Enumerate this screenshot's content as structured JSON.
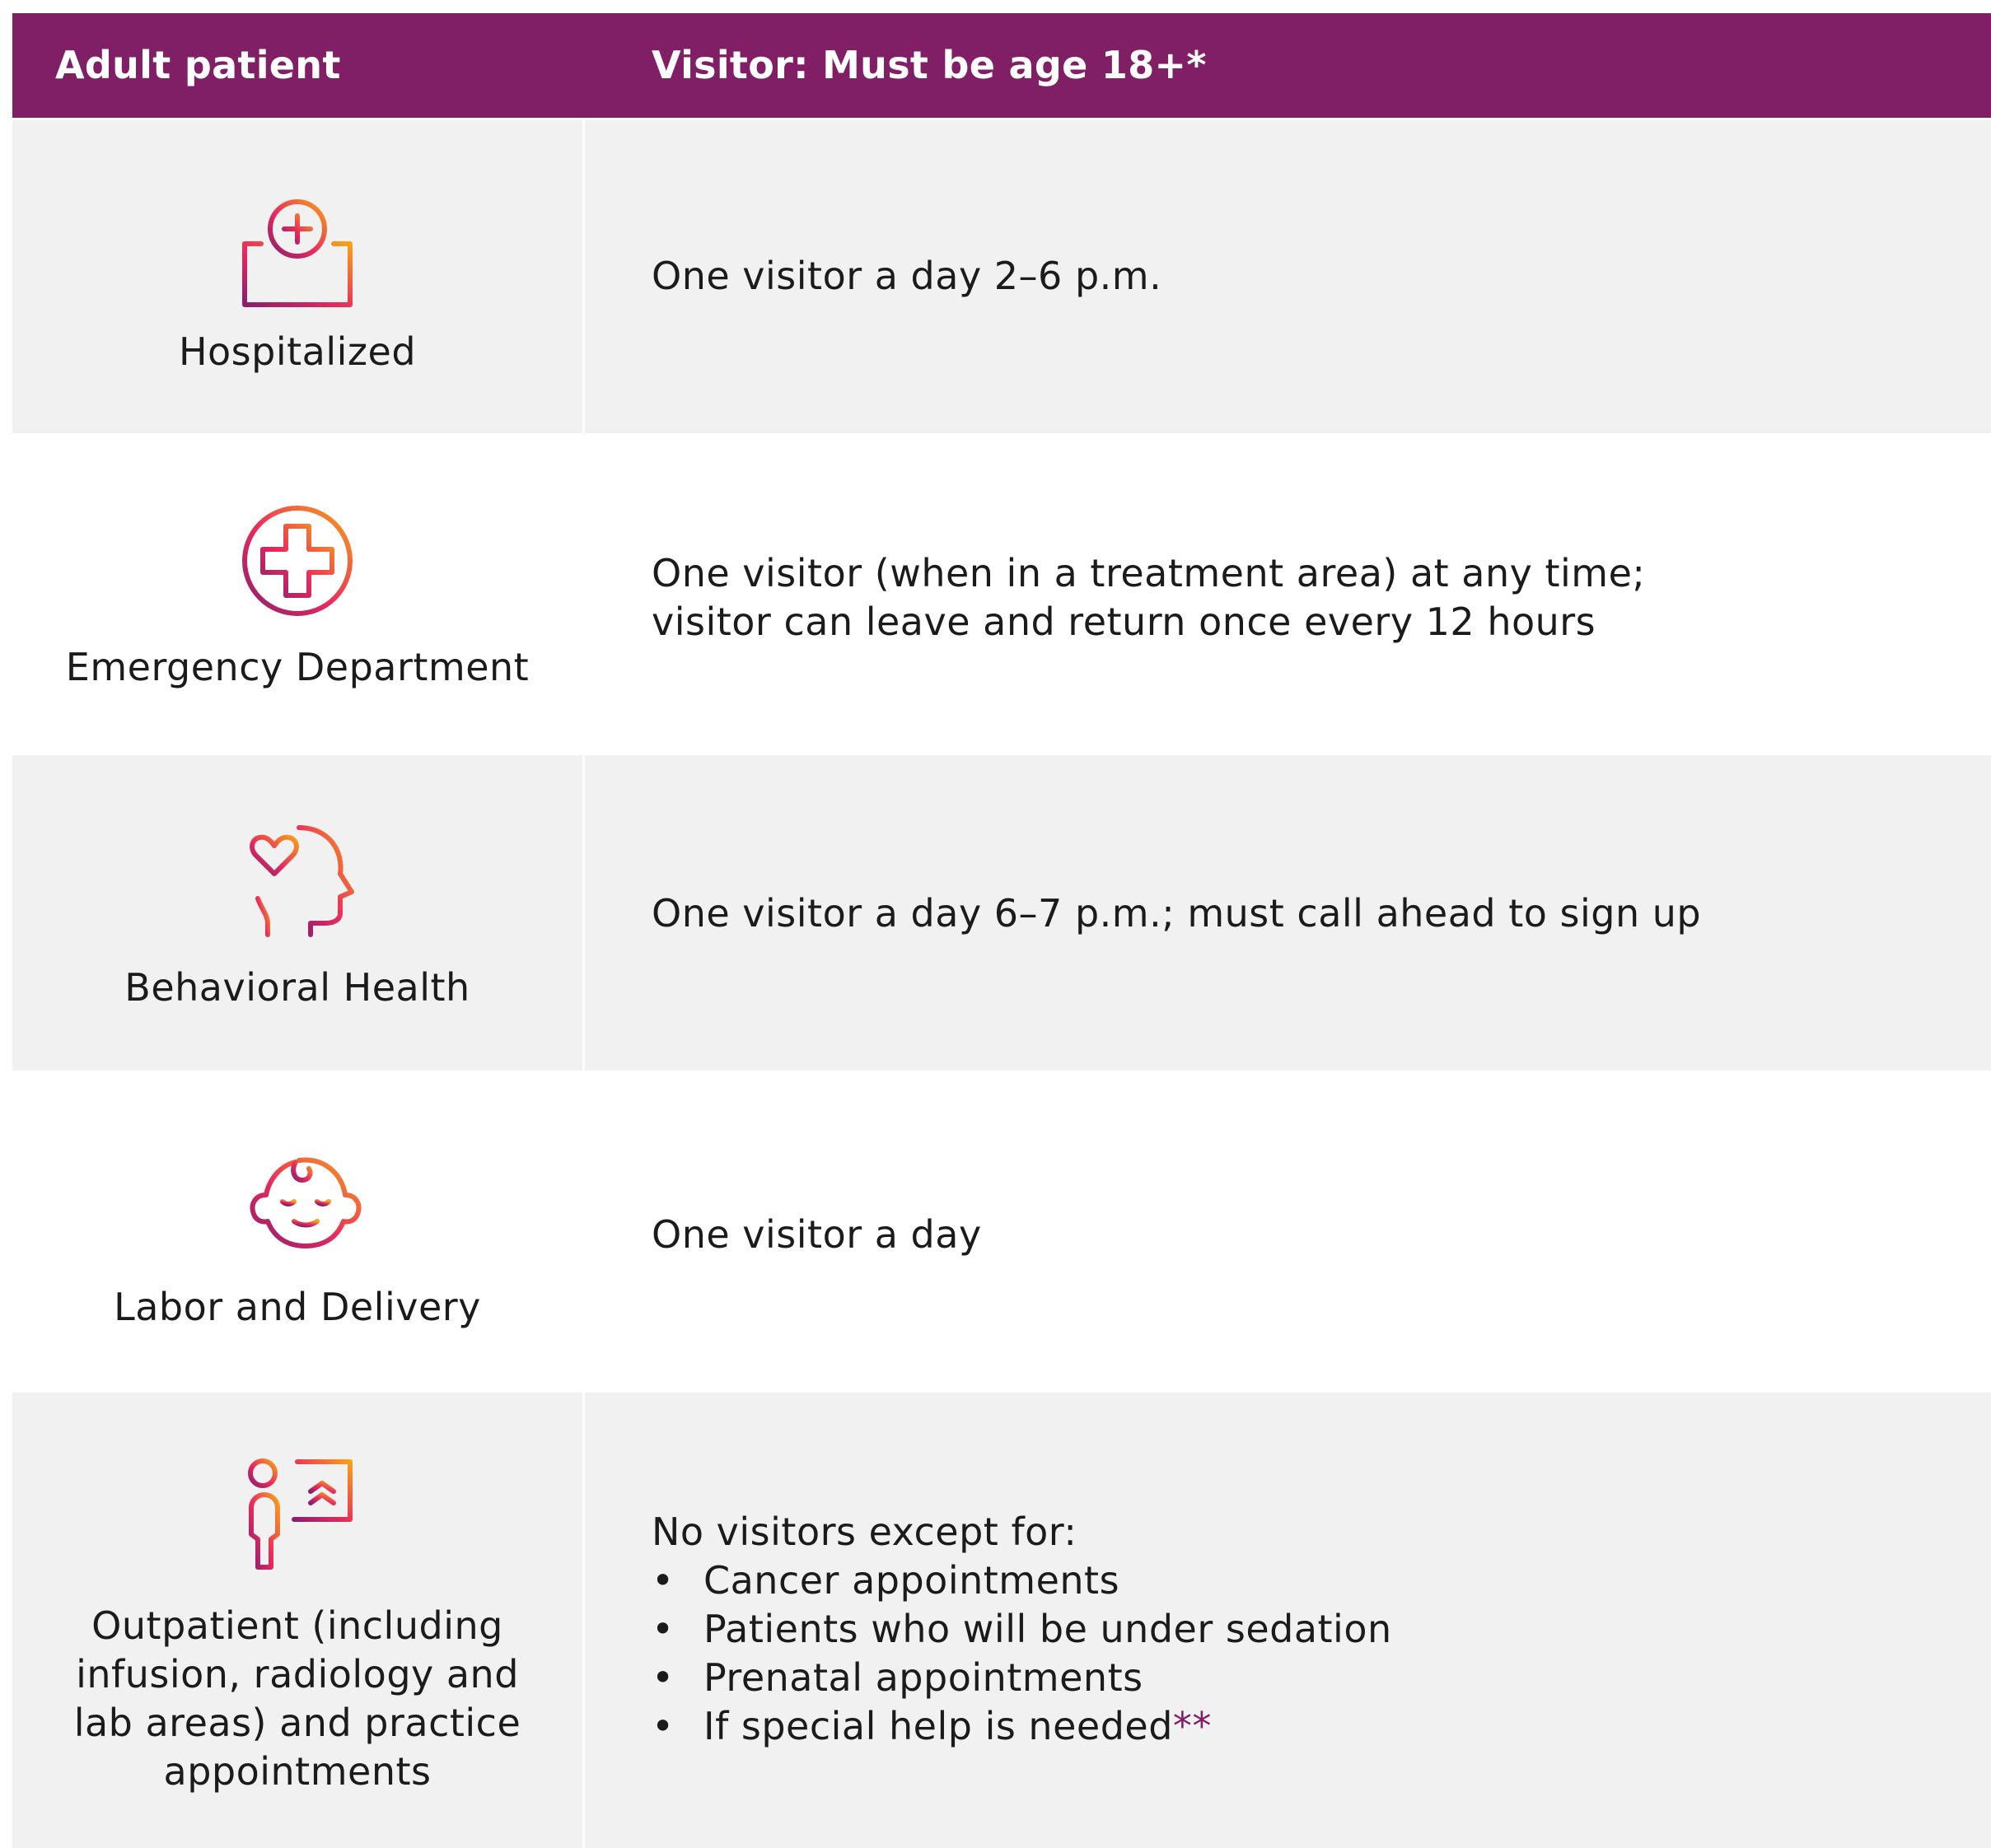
{
  "header": {
    "col1": "Adult patient",
    "col2": "Visitor: Must be age 18+*"
  },
  "colors": {
    "header_bg": "#801f66",
    "row_shade": "#f0f1f0",
    "icon_gradient": [
      "#f7a21b",
      "#ea2a5c",
      "#8a1f6e"
    ]
  },
  "rows": [
    {
      "icon": "hospital-icon",
      "label": "Hospitalized",
      "description": "One visitor a day 2–6 p.m."
    },
    {
      "icon": "medical-cross-icon",
      "label": "Emergency Department",
      "description_lines": [
        "One visitor (when in a treatment area) at any time;",
        "visitor can leave and return once every 12 hours"
      ]
    },
    {
      "icon": "head-heart-icon",
      "label": "Behavioral Health",
      "description": "One visitor a day 6–7 p.m.; must call ahead to sign up"
    },
    {
      "icon": "baby-face-icon",
      "label": "Labor and Delivery",
      "description": "One visitor a day"
    },
    {
      "icon": "outpatient-xray-icon",
      "label": "Outpatient (including\ninfusion, radiology and\nlab areas) and practice\nappointments",
      "description": "No visitors except for:",
      "bullets": [
        "Cancer appointments",
        "Patients who will be under sedation",
        "Prenatal appointments",
        "If special help is needed"
      ],
      "footnote_mark": "**"
    }
  ]
}
